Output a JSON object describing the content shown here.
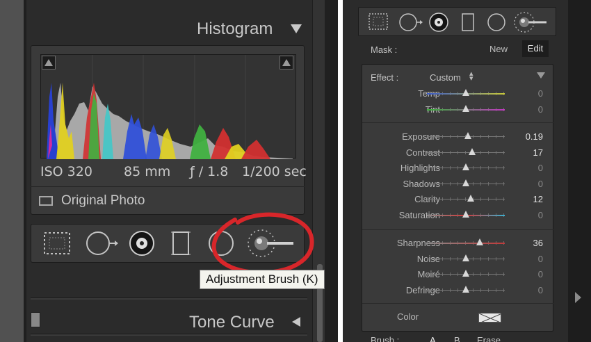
{
  "left_panel": {
    "histogram": {
      "title": "Histogram",
      "exif": {
        "iso": "ISO 320",
        "focal": "85 mm",
        "aperture": "ƒ / 1.8",
        "shutter": "1/200 sec"
      },
      "original_photo_label": "Original Photo"
    },
    "tools": [
      "crop-overlay",
      "spot-removal",
      "red-eye",
      "graduated-filter",
      "radial-filter",
      "adjustment-brush"
    ],
    "tooltip": "Adjustment Brush (K)",
    "next_section_title": "Tone Curve",
    "highlight_color": "#d8262a"
  },
  "right_panel": {
    "mask": {
      "label": "Mask :",
      "new": "New",
      "edit": "Edit"
    },
    "effect": {
      "label": "Effect :",
      "value": "Custom"
    },
    "groups": [
      [
        {
          "label": "Temp",
          "value": "0",
          "pos": 0.5,
          "track": "temp"
        },
        {
          "label": "Tint",
          "value": "0",
          "pos": 0.5,
          "track": "tint"
        }
      ],
      [
        {
          "label": "Exposure",
          "value": "0.19",
          "pos": 0.53
        },
        {
          "label": "Contrast",
          "value": "17",
          "pos": 0.58
        },
        {
          "label": "Highlights",
          "value": "0",
          "pos": 0.5
        },
        {
          "label": "Shadows",
          "value": "0",
          "pos": 0.5
        },
        {
          "label": "Clarity",
          "value": "12",
          "pos": 0.56
        },
        {
          "label": "Saturation",
          "value": "0",
          "pos": 0.5,
          "track": "sat"
        }
      ],
      [
        {
          "label": "Sharpness",
          "value": "36",
          "pos": 0.68,
          "track": "sharp"
        },
        {
          "label": "Noise",
          "value": "0",
          "pos": 0.5
        },
        {
          "label": "Moiré",
          "value": "0",
          "pos": 0.5
        },
        {
          "label": "Defringe",
          "value": "0",
          "pos": 0.5
        }
      ]
    ],
    "color_label": "Color",
    "brush": {
      "label": "Brush :",
      "a": "A",
      "b": "B",
      "erase": "Erase"
    }
  }
}
